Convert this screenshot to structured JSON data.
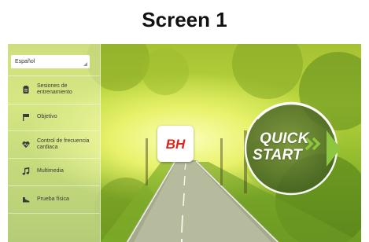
{
  "heading": "Screen 1",
  "language_select": {
    "value": "Español"
  },
  "menu": [
    {
      "label": "Sesiones de entrenamiento",
      "icon": "clipboard-icon"
    },
    {
      "label": "Objetivo",
      "icon": "flag-icon"
    },
    {
      "label": "Control de frecuencia cardiaca",
      "icon": "heart-rate-icon"
    },
    {
      "label": "Multimedia",
      "icon": "music-note-icon"
    },
    {
      "label": "Prueba física",
      "icon": "shoe-icon"
    }
  ],
  "logo": {
    "text": "BH",
    "color": "#e2231a"
  },
  "quick_start": {
    "line1": "QUICK",
    "line2": "START",
    "accent": "#8dc63f"
  }
}
